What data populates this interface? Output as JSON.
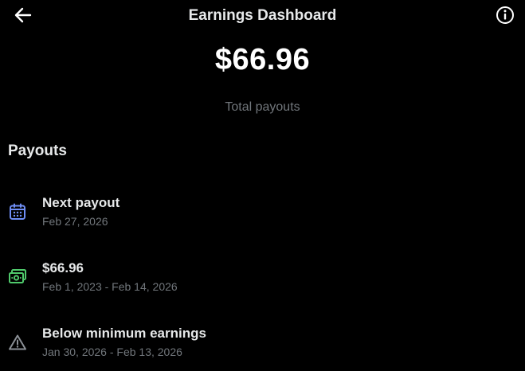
{
  "header": {
    "title": "Earnings Dashboard",
    "back_icon": "arrow-left-icon",
    "info_icon": "info-circle-icon"
  },
  "summary": {
    "amount": "$66.96",
    "caption": "Total payouts"
  },
  "payouts": {
    "section_title": "Payouts",
    "items": [
      {
        "icon": "calendar-icon",
        "icon_color": "#6f8ef5",
        "title": "Next payout",
        "subtitle": "Feb 27, 2026"
      },
      {
        "icon": "money-icon",
        "icon_color": "#4fc96b",
        "title": "$66.96",
        "subtitle": "Feb 1, 2023 - Feb 14, 2026"
      },
      {
        "icon": "warning-triangle-icon",
        "icon_color": "#8b9096",
        "title": "Below minimum earnings",
        "subtitle": "Jan 30, 2026 - Feb 13, 2026"
      }
    ]
  },
  "colors": {
    "background": "#000000",
    "primary_text": "#e7e9ea",
    "secondary_text": "#71767b"
  }
}
